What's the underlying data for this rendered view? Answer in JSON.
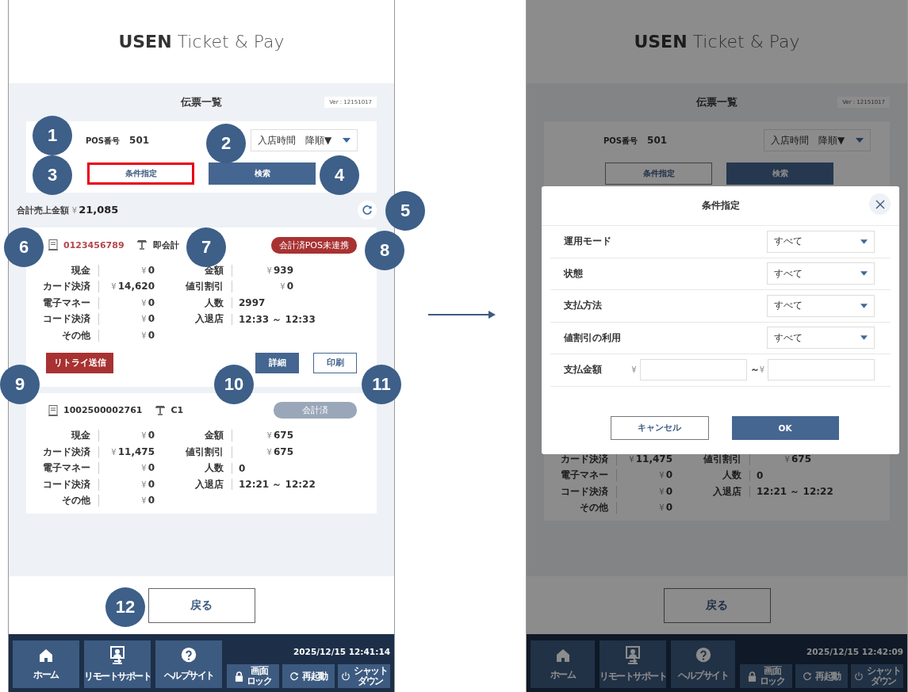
{
  "screens": [
    {
      "logo_brand": "USEN",
      "logo_product": "Ticket & Pay",
      "title": "伝票一覧",
      "version": "Ver : 12151017",
      "pos_label": "POS番号",
      "pos_value": "501",
      "sort_value": "入店時間　降順▼",
      "filter_button": {
        "label": "条件指定",
        "highlighted": true
      },
      "search_button": "検索",
      "total": {
        "label": "合計売上金額",
        "currency": "¥",
        "value": "21,085"
      },
      "dimmed": false,
      "tickets": [
        {
          "number": "0123456789",
          "table": "即会計",
          "kind": "unsynced",
          "badge": "会計済POS未連携",
          "rows": [
            {
              "cells": [
                {
                  "label": "現金",
                  "currency": "¥",
                  "value": "0"
                },
                {
                  "label": "金額",
                  "currency": "¥",
                  "value": "939"
                }
              ]
            },
            {
              "cells": [
                {
                  "label": "カード決済",
                  "currency": "¥",
                  "value": "14,620"
                },
                {
                  "label": "値引割引",
                  "currency": "¥",
                  "value": "0"
                }
              ]
            },
            {
              "cells": [
                {
                  "label": "電子マネー",
                  "currency": "¥",
                  "value": "0"
                },
                {
                  "label": "人数",
                  "value": "2997"
                }
              ]
            },
            {
              "cells": [
                {
                  "label": "コード決済",
                  "currency": "¥",
                  "value": "0"
                },
                {
                  "label": "入退店",
                  "value": "12:33 ～ 12:33"
                }
              ]
            },
            {
              "cells": [
                {
                  "label": "その他",
                  "currency": "¥",
                  "value": "0"
                }
              ]
            }
          ],
          "actions": [
            {
              "kind": "retry",
              "label": "リトライ送信"
            },
            {
              "kind": "detail",
              "label": "詳細"
            },
            {
              "kind": "print",
              "label": "印刷"
            }
          ]
        },
        {
          "number": "1002500002761",
          "table": "C1",
          "kind": "paid",
          "badge": "会計済",
          "rows": [
            {
              "cells": [
                {
                  "label": "現金",
                  "currency": "¥",
                  "value": "0"
                },
                {
                  "label": "金額",
                  "currency": "¥",
                  "value": "675"
                }
              ]
            },
            {
              "cells": [
                {
                  "label": "カード決済",
                  "currency": "¥",
                  "value": "11,475"
                },
                {
                  "label": "値引割引",
                  "currency": "¥",
                  "value": "675"
                }
              ]
            },
            {
              "cells": [
                {
                  "label": "電子マネー",
                  "currency": "¥",
                  "value": "0"
                },
                {
                  "label": "人数",
                  "value": "0"
                }
              ]
            },
            {
              "cells": [
                {
                  "label": "コード決済",
                  "currency": "¥",
                  "value": "0"
                },
                {
                  "label": "入退店",
                  "value": "12:21 ～ 12:22"
                }
              ]
            },
            {
              "cells": [
                {
                  "label": "その他",
                  "currency": "¥",
                  "value": "0"
                }
              ]
            }
          ]
        }
      ],
      "back_button": "戻る",
      "footer": {
        "nav": [
          {
            "kind": "home",
            "label": "ホーム"
          },
          {
            "kind": "remote",
            "label": "リモートサポート"
          },
          {
            "kind": "help",
            "label": "ヘルプサイト"
          }
        ],
        "datetime": "2025/12/15 12:41:14",
        "actions": [
          {
            "kind": "lock",
            "lines": [
              "画面",
              "ロック"
            ]
          },
          {
            "kind": "restart",
            "lines": [
              "再起動"
            ]
          },
          {
            "kind": "shutdown",
            "lines": [
              "シャット",
              "ダウン"
            ]
          }
        ]
      }
    },
    {
      "logo_brand": "USEN",
      "logo_product": "Ticket & Pay",
      "title": "伝票一覧",
      "version": "Ver : 12151017",
      "pos_label": "POS番号",
      "pos_value": "501",
      "sort_value": "入店時間　降順▼",
      "filter_button": {
        "label": "条件指定",
        "highlighted": false
      },
      "search_button": "検索",
      "dimmed": true,
      "tickets": [
        {
          "rows": [
            {
              "cells": [
                {
                  "label": "カード決済",
                  "currency": "¥",
                  "value": "11,475"
                },
                {
                  "label": "値引割引",
                  "currency": "¥",
                  "value": "675"
                }
              ]
            },
            {
              "cells": [
                {
                  "label": "電子マネー",
                  "currency": "¥",
                  "value": "0"
                },
                {
                  "label": "人数",
                  "value": "0"
                }
              ]
            },
            {
              "cells": [
                {
                  "label": "コード決済",
                  "currency": "¥",
                  "value": "0"
                },
                {
                  "label": "入退店",
                  "value": "12:21 ～ 12:22"
                }
              ]
            },
            {
              "cells": [
                {
                  "label": "その他",
                  "currency": "¥",
                  "value": "0"
                }
              ]
            }
          ]
        }
      ],
      "back_button": "戻る",
      "footer": {
        "nav": [
          {
            "kind": "home",
            "label": "ホーム"
          },
          {
            "kind": "remote",
            "label": "リモートサポート"
          },
          {
            "kind": "help",
            "label": "ヘルプサイト"
          }
        ],
        "datetime": "2025/12/15 12:42:09",
        "actions": [
          {
            "kind": "lock",
            "lines": [
              "画面",
              "ロック"
            ]
          },
          {
            "kind": "restart",
            "lines": [
              "再起動"
            ]
          },
          {
            "kind": "shutdown",
            "lines": [
              "シャット",
              "ダウン"
            ]
          }
        ]
      },
      "modal": {
        "title": "条件指定",
        "fields": [
          {
            "kind": "select",
            "label": "運用モード",
            "value": "すべて"
          },
          {
            "kind": "select",
            "label": "状態",
            "value": "すべて"
          },
          {
            "kind": "select",
            "label": "支払方法",
            "value": "すべて"
          },
          {
            "kind": "select",
            "label": "値割引の利用",
            "value": "すべて"
          },
          {
            "kind": "range",
            "label": "支払金額",
            "from_currency": "¥",
            "separator": "～",
            "to_currency": "¥"
          }
        ],
        "buttons": [
          {
            "kind": "secondary",
            "label": "キャンセル"
          },
          {
            "kind": "primary",
            "label": "OK"
          }
        ]
      }
    }
  ],
  "callouts": [
    "1",
    "2",
    "3",
    "4",
    "5",
    "6",
    "7",
    "8",
    "9",
    "10",
    "11",
    "12"
  ]
}
